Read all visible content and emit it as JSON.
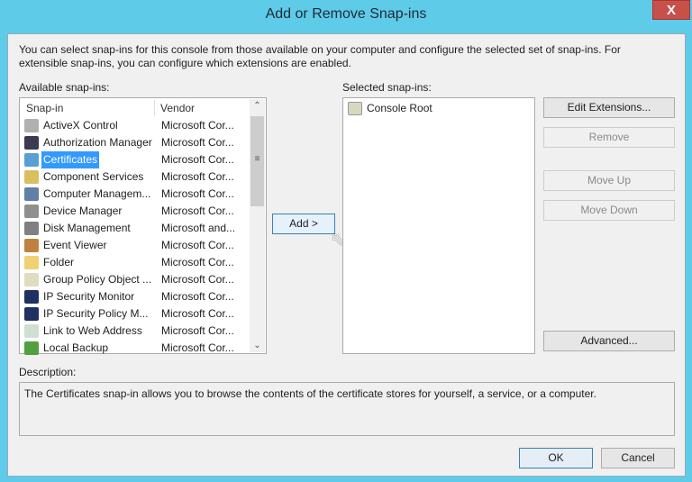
{
  "window": {
    "title": "Add or Remove Snap-ins",
    "close_label": "X"
  },
  "intro": "You can select snap-ins for this console from those available on your computer and configure the selected set of snap-ins. For extensible snap-ins, you can configure which extensions are enabled.",
  "available": {
    "label": "Available snap-ins:",
    "columns": [
      "Snap-in",
      "Vendor"
    ],
    "items": [
      {
        "name": "ActiveX Control",
        "vendor": "Microsoft Cor...",
        "icon": "activex-icon",
        "color": "#b0b0b0"
      },
      {
        "name": "Authorization Manager",
        "vendor": "Microsoft Cor...",
        "icon": "authorization-icon",
        "color": "#3a3a50"
      },
      {
        "name": "Certificates",
        "vendor": "Microsoft Cor...",
        "icon": "certificates-icon",
        "color": "#5a9fd4",
        "selected": true
      },
      {
        "name": "Component Services",
        "vendor": "Microsoft Cor...",
        "icon": "component-services-icon",
        "color": "#d8c060"
      },
      {
        "name": "Computer Managem...",
        "vendor": "Microsoft Cor...",
        "icon": "computer-management-icon",
        "color": "#6080a8"
      },
      {
        "name": "Device Manager",
        "vendor": "Microsoft Cor...",
        "icon": "device-manager-icon",
        "color": "#909090"
      },
      {
        "name": "Disk Management",
        "vendor": "Microsoft and...",
        "icon": "disk-management-icon",
        "color": "#808080"
      },
      {
        "name": "Event Viewer",
        "vendor": "Microsoft Cor...",
        "icon": "event-viewer-icon",
        "color": "#c08040"
      },
      {
        "name": "Folder",
        "vendor": "Microsoft Cor...",
        "icon": "folder-icon",
        "color": "#f0d070"
      },
      {
        "name": "Group Policy Object ...",
        "vendor": "Microsoft Cor...",
        "icon": "group-policy-icon",
        "color": "#e0dcc0"
      },
      {
        "name": "IP Security Monitor",
        "vendor": "Microsoft Cor...",
        "icon": "ip-security-monitor-icon",
        "color": "#203060"
      },
      {
        "name": "IP Security Policy M...",
        "vendor": "Microsoft Cor...",
        "icon": "ip-security-policy-icon",
        "color": "#203060"
      },
      {
        "name": "Link to Web Address",
        "vendor": "Microsoft Cor...",
        "icon": "web-link-icon",
        "color": "#d0e0d0"
      },
      {
        "name": "Local Backup",
        "vendor": "Microsoft Cor...",
        "icon": "backup-icon",
        "color": "#50a040"
      }
    ]
  },
  "add_label": "Add >",
  "selected": {
    "label": "Selected snap-ins:",
    "items": [
      {
        "name": "Console Root"
      }
    ]
  },
  "buttons": {
    "edit_extensions": "Edit Extensions...",
    "remove": "Remove",
    "move_up": "Move Up",
    "move_down": "Move Down",
    "advanced": "Advanced...",
    "ok": "OK",
    "cancel": "Cancel"
  },
  "description": {
    "label": "Description:",
    "text": "The Certificates snap-in allows you to browse the contents of the certificate stores for yourself, a service, or a computer."
  }
}
